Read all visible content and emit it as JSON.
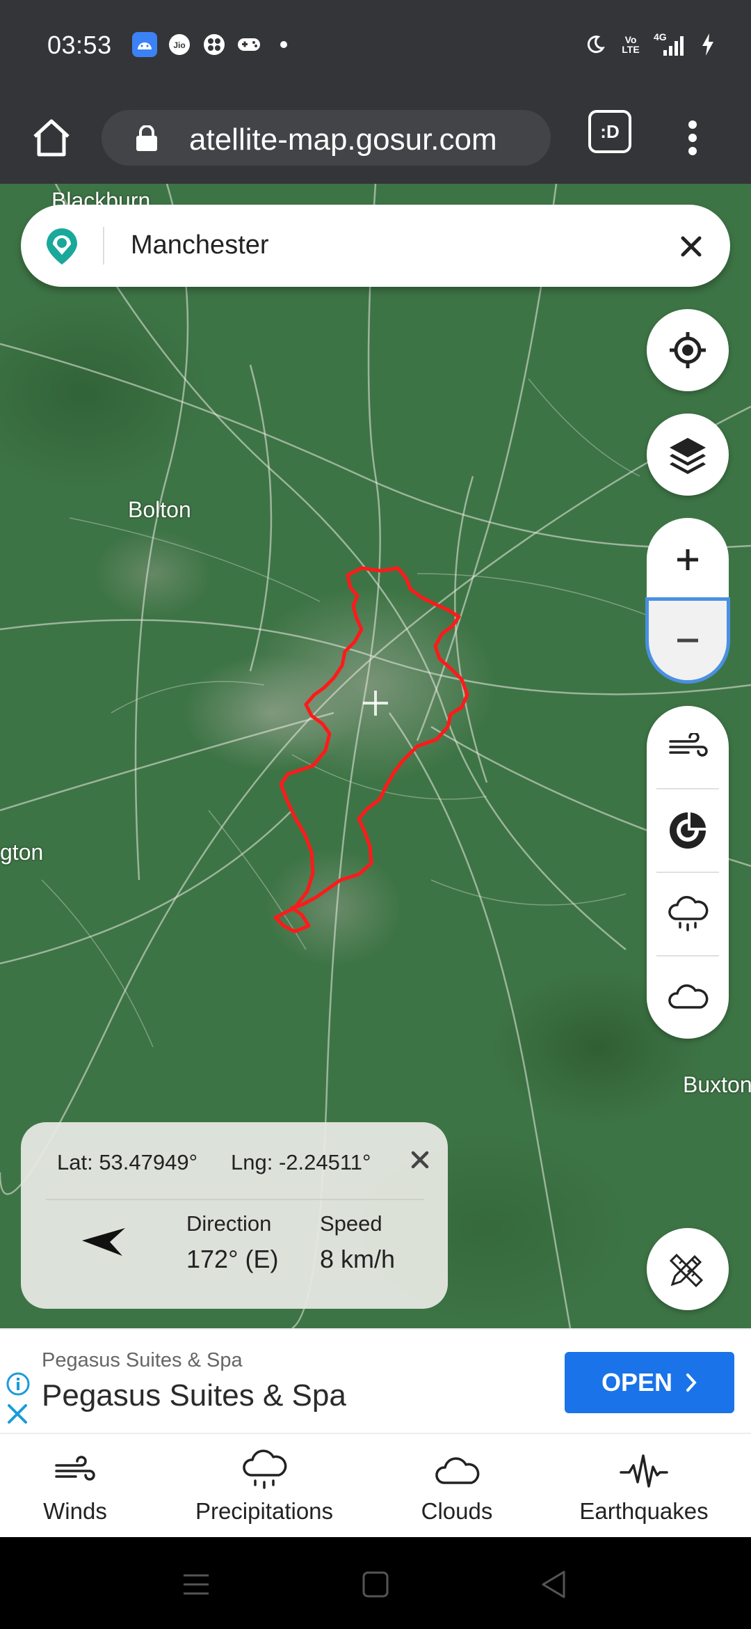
{
  "status_bar": {
    "time": "03:53",
    "left_icons": [
      "android-notification-icon",
      "jio-icon",
      "game-icon",
      "controller-icon",
      "dot-icon"
    ],
    "network_lte_top": "Vo",
    "network_lte_bottom": "LTE",
    "network_4g": "4G",
    "right_icons": [
      "moon-icon",
      "signal-icon",
      "charging-icon"
    ]
  },
  "browser": {
    "url": "atellite-map.gosur.com",
    "tab_label": ":D"
  },
  "search": {
    "value": "Manchester"
  },
  "map_labels": {
    "blackburn": "Blackburn",
    "bolton": "Bolton",
    "warrington": "gton",
    "buxton": "Buxton"
  },
  "info": {
    "lat": "Lat: 53.47949°",
    "lng": "Lng: -2.24511°",
    "direction_label": "Direction",
    "direction_value": "172° (E)",
    "speed_label": "Speed",
    "speed_value": "8 km/h"
  },
  "ad": {
    "small_title": "Pegasus Suites & Spa",
    "title": "Pegasus Suites & Spa",
    "button": "OPEN"
  },
  "bottom_nav": {
    "items": [
      {
        "label": "Winds",
        "icon": "wind-icon"
      },
      {
        "label": "Precipitations",
        "icon": "rain-cloud-icon"
      },
      {
        "label": "Clouds",
        "icon": "cloud-icon"
      },
      {
        "label": "Earthquakes",
        "icon": "seismograph-icon"
      }
    ]
  },
  "colors": {
    "boundary": "#ff1a1a",
    "accent": "#1a73e8",
    "logo": "#1aa89a",
    "status_bg": "#343538"
  }
}
